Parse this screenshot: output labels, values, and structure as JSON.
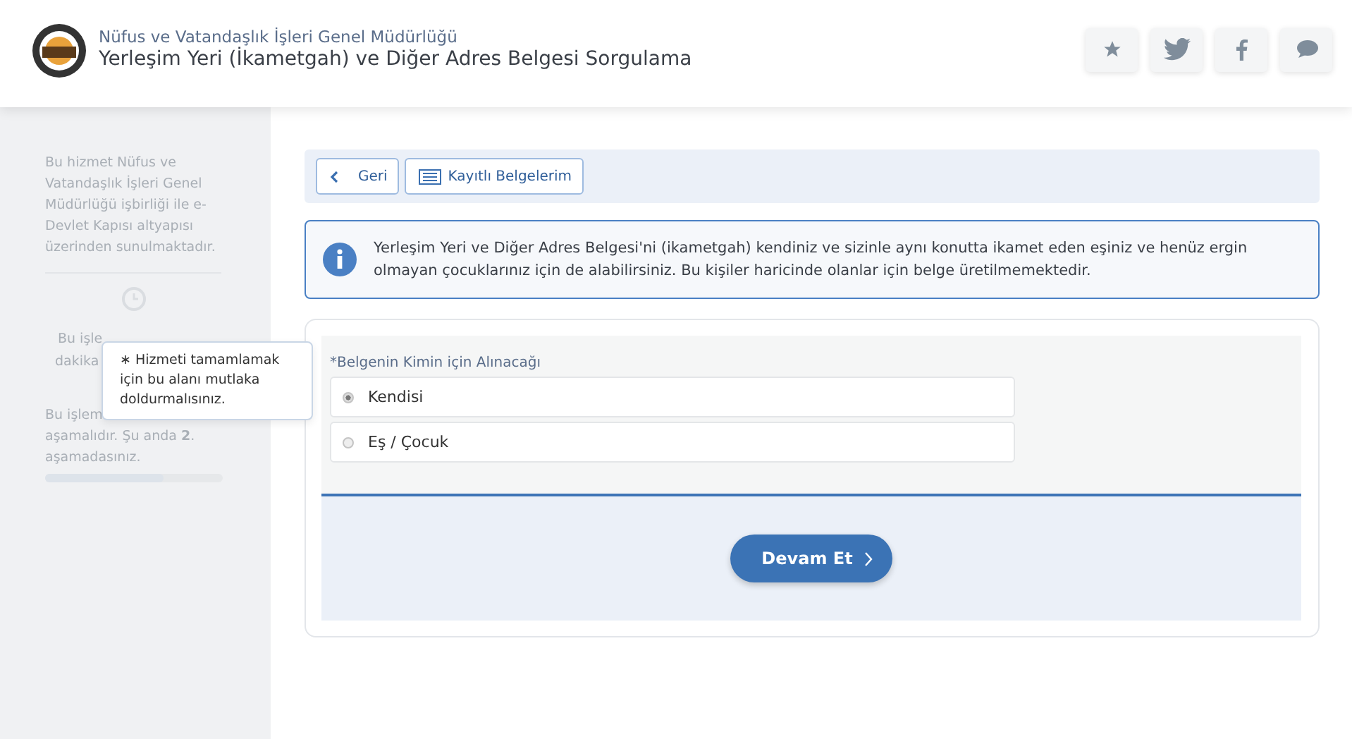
{
  "header": {
    "organization": "Nüfus ve Vatandaşlık İşleri Genel Müdürlüğü",
    "title": "Yerleşim Yeri (İkametgah) ve Diğer Adres Belgesi Sorgulama",
    "actions": [
      {
        "kind": "star"
      },
      {
        "kind": "twitter"
      },
      {
        "kind": "facebook"
      },
      {
        "kind": "chat"
      }
    ]
  },
  "sidebar": {
    "intro": "Bu hizmet Nüfus ve Vatandaşlık İşleri Genel Müdürlüğü işbirliği ile e-Devlet Kapısı altyapısı üzerinden sunulmaktadır.",
    "duration_lines": [
      "Bu işle",
      "dakika"
    ],
    "step_lines": [
      "Bu işlem",
      "aşamalıdır. Şu anda **2**.",
      "aşamadasınız."
    ],
    "progress": {
      "level": 0.67
    }
  },
  "tooltip": "∗ Hizmeti tamamlamak için bu alanı mutlaka doldurmalısınız.",
  "toolbar": [
    {
      "kind": "back",
      "label": "Geri"
    },
    {
      "kind": "documents",
      "label": "Kayıtlı Belgelerim"
    }
  ],
  "info": "Yerleşim Yeri ve Diğer Adres Belgesi'ni (ikametgah) kendiniz ve sizinle aynı konutta ikamet eden eşiniz ve henüz ergin olmayan çocuklarınız için de alabilirsiniz. Bu kişiler haricinde olanlar için belge üretilmemektedir.",
  "form": {
    "label": "*Belgenin Kimin için Alınacağı",
    "options": [
      {
        "label": "Kendisi",
        "selected": true
      },
      {
        "label": "Eş / Çocuk",
        "selected": false
      }
    ],
    "submit": "Devam Et"
  }
}
